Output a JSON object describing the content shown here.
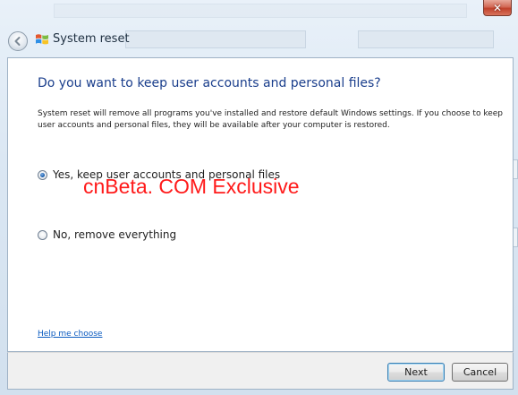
{
  "window": {
    "title": "System reset",
    "close_glyph": "✕",
    "colors": {
      "main_instruction": "#1a3e8c",
      "link": "#0b5bc0",
      "watermark": "#ff1a1a"
    }
  },
  "content": {
    "main_instruction": "Do you want to keep user accounts and personal files?",
    "description": "System reset will remove all programs you've installed and restore default Windows settings. If you choose to keep user accounts and personal files, they will be available after your computer is restored.",
    "options": [
      {
        "label": "Yes, keep user accounts and personal files",
        "selected": true
      },
      {
        "label": "No, remove everything",
        "selected": false
      }
    ],
    "watermark": "cnBeta. COM Exclusive",
    "help_link": "Help me choose"
  },
  "footer": {
    "next_label": "Next",
    "cancel_label": "Cancel"
  },
  "icons": {
    "back": "back-arrow-icon",
    "window": "windows-logo-icon",
    "close": "close-icon"
  }
}
